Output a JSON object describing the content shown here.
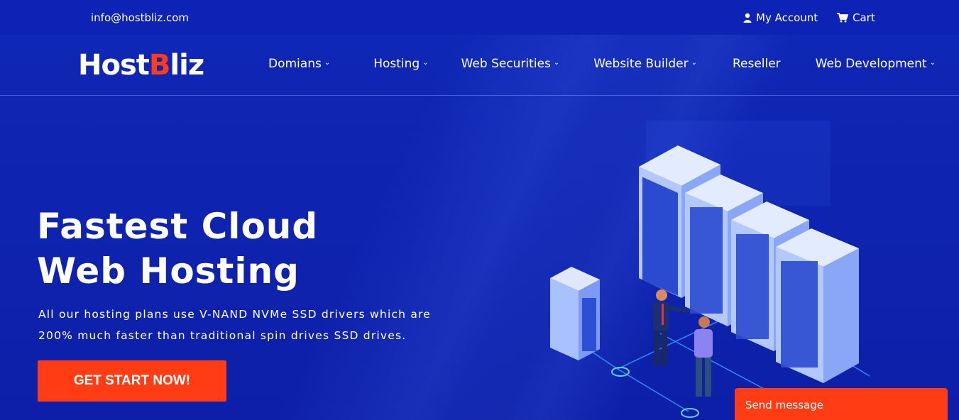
{
  "topbar": {
    "email": "info@hostbliz.com",
    "account_label": "My Account",
    "cart_label": "Cart"
  },
  "logo": {
    "part1": "Host",
    "part2": "B",
    "part3": "liz"
  },
  "nav": {
    "items": [
      {
        "label": "Domians",
        "dropdown": true
      },
      {
        "label": "Hosting",
        "dropdown": true
      },
      {
        "label": "Web Securities",
        "dropdown": true
      },
      {
        "label": "Website Builder",
        "dropdown": true
      },
      {
        "label": "Reseller",
        "dropdown": false
      },
      {
        "label": "Web Development",
        "dropdown": true
      }
    ]
  },
  "hero": {
    "title_line1": "Fastest Cloud",
    "title_line2": "Web Hosting",
    "desc_line1": "All our hosting plans use V-NAND NVMe SSD drivers which are",
    "desc_line2": "200% much faster than traditional spin drives SSD drives.",
    "cta_label": "GET START NOW!"
  },
  "chat": {
    "label": "Send message"
  },
  "colors": {
    "brand_orange": "#ff3c14",
    "bg_blue": "#0e23b0"
  },
  "icons": {
    "account": "user-icon",
    "cart": "cart-icon",
    "chevron": "chevron-down-icon"
  }
}
